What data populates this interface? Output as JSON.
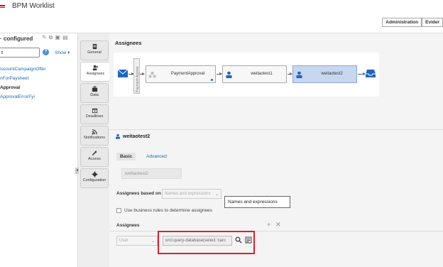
{
  "app": {
    "title": "BPM Worklist"
  },
  "topnav": {
    "admin": "Administration",
    "evidence": "Evider"
  },
  "left": {
    "title": "· configured",
    "search_value": "t",
    "show_label": "Show ▾",
    "items": [
      {
        "label": "iscountCampaignOffer",
        "active": false
      },
      {
        "label": "nForPaysheet",
        "active": false
      },
      {
        "label": "Approval",
        "active": true
      },
      {
        "label": "ApprovalErrorFyi",
        "active": false
      }
    ]
  },
  "vtabs": [
    {
      "label": "General"
    },
    {
      "label": "Assignees"
    },
    {
      "label": "Data"
    },
    {
      "label": "Deadlines"
    },
    {
      "label": "Notifications"
    },
    {
      "label": "Access"
    },
    {
      "label": "Configuration"
    }
  ],
  "flow": {
    "section_title": "Assignees",
    "lane_label": "Payment Approv",
    "nodes": [
      "PaymentApproval",
      "weitaotest1",
      "weitaotest2"
    ]
  },
  "detail": {
    "participant": "weitaotest2",
    "tab_basic": "Basic",
    "tab_advanced": "Advanced",
    "name_value": "weitaotest2",
    "based_on_label": "Assignees based on",
    "based_on_value": "Names and expressions",
    "tooltip": "Names and expressions",
    "business_rules_label": "Use business rules to determine assignees",
    "assignees_label": "Assignees",
    "user_type": "User",
    "query_value": "orcl:query-database(select 'carc"
  },
  "colors": {
    "accent": "#1a6bb3",
    "highlight_box": "#e0202a",
    "selected_node": "#c7d7ef"
  }
}
